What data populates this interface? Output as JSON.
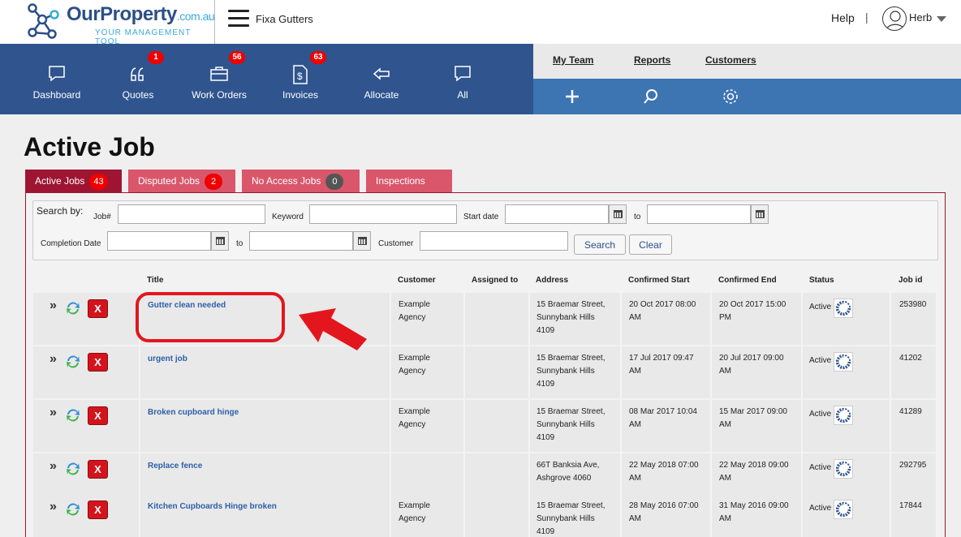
{
  "header": {
    "logo_name": "OurProperty",
    "logo_domain": ".com.au",
    "logo_tagline": "YOUR MANAGEMENT TOOL",
    "company": "Fixa Gutters",
    "help": "Help",
    "separator": "|",
    "user": "Herb"
  },
  "nav": {
    "items": [
      {
        "label": "Dashboard",
        "icon": "chat-icon"
      },
      {
        "label": "Quotes",
        "icon": "quote-icon",
        "badge": "1"
      },
      {
        "label": "Work Orders",
        "icon": "briefcase-icon",
        "badge": "56"
      },
      {
        "label": "Invoices",
        "icon": "invoice-icon",
        "badge": "63"
      },
      {
        "label": "Allocate",
        "icon": "arrow-left-icon"
      },
      {
        "label": "All",
        "icon": "chat-icon"
      }
    ]
  },
  "subnav": {
    "links": [
      "My Team",
      "Reports",
      "Customers"
    ]
  },
  "page": {
    "title": "Active Job"
  },
  "tabs": [
    {
      "label": "Active Jobs",
      "count": "43"
    },
    {
      "label": "Disputed Jobs",
      "count": "2"
    },
    {
      "label": "No Access Jobs",
      "count": "0"
    },
    {
      "label": "Inspections"
    }
  ],
  "search": {
    "heading": "Search by:",
    "job_label": "Job#",
    "keyword_label": "Keyword",
    "start_label": "Start date",
    "to_label": "to",
    "completion_label": "Completion Date",
    "customer_label": "Customer",
    "search_button": "Search",
    "clear_button": "Clear"
  },
  "table": {
    "columns": [
      "Title",
      "Customer",
      "Assigned to",
      "Address",
      "Confirmed Start",
      "Confirmed End",
      "Status",
      "Job id"
    ],
    "rows": [
      {
        "title": "Gutter clean needed",
        "customer": [
          "Example",
          "Agency"
        ],
        "address": [
          "15 Braemar Street,",
          "Sunnybank Hills",
          "4109"
        ],
        "start": [
          "20 Oct 2017 08:00",
          "AM"
        ],
        "end": [
          "20 Oct 2017 15:00",
          "PM"
        ],
        "status": "Active",
        "job_id": "253980"
      },
      {
        "title": "urgent job",
        "customer": [
          "Example",
          "Agency"
        ],
        "address": [
          "15 Braemar Street,",
          "Sunnybank Hills",
          "4109"
        ],
        "start": [
          "17 Jul 2017 09:47",
          "AM"
        ],
        "end": [
          "20 Jul 2017 09:00",
          "AM"
        ],
        "status": "Active",
        "job_id": "41202"
      },
      {
        "title": "Broken cupboard hinge",
        "customer": [
          "Example",
          "Agency"
        ],
        "address": [
          "15 Braemar Street,",
          "Sunnybank Hills",
          "4109"
        ],
        "start": [
          "08 Mar 2017 10:04",
          "AM"
        ],
        "end": [
          "15 Mar 2017 09:00",
          "AM"
        ],
        "status": "Active",
        "job_id": "41289"
      },
      {
        "title": "Replace fence",
        "customer": [
          "",
          ""
        ],
        "address": [
          "66T Banksia Ave,",
          "Ashgrove 4060",
          ""
        ],
        "start": [
          "22 May 2018 07:00",
          "AM"
        ],
        "end": [
          "22 May 2018 09:00",
          "AM"
        ],
        "status": "Active",
        "job_id": "292795"
      },
      {
        "title": "Kitchen Cupboards Hinge broken",
        "customer": [
          "Example",
          "Agency"
        ],
        "address": [
          "15 Braemar Street,",
          "Sunnybank Hills",
          "4109"
        ],
        "start": [
          "28 May 2016 07:00",
          "AM"
        ],
        "end": [
          "31 May 2016 09:00",
          "AM"
        ],
        "status": "Active",
        "job_id": "17844"
      }
    ]
  },
  "colors": {
    "nav_bg": "#2f548e",
    "toolbar_bg": "#3d74b2",
    "tab_active": "#9e1533",
    "tab_inactive": "#d9566b",
    "link": "#2c5fa8",
    "annotation": "#e3161e"
  }
}
